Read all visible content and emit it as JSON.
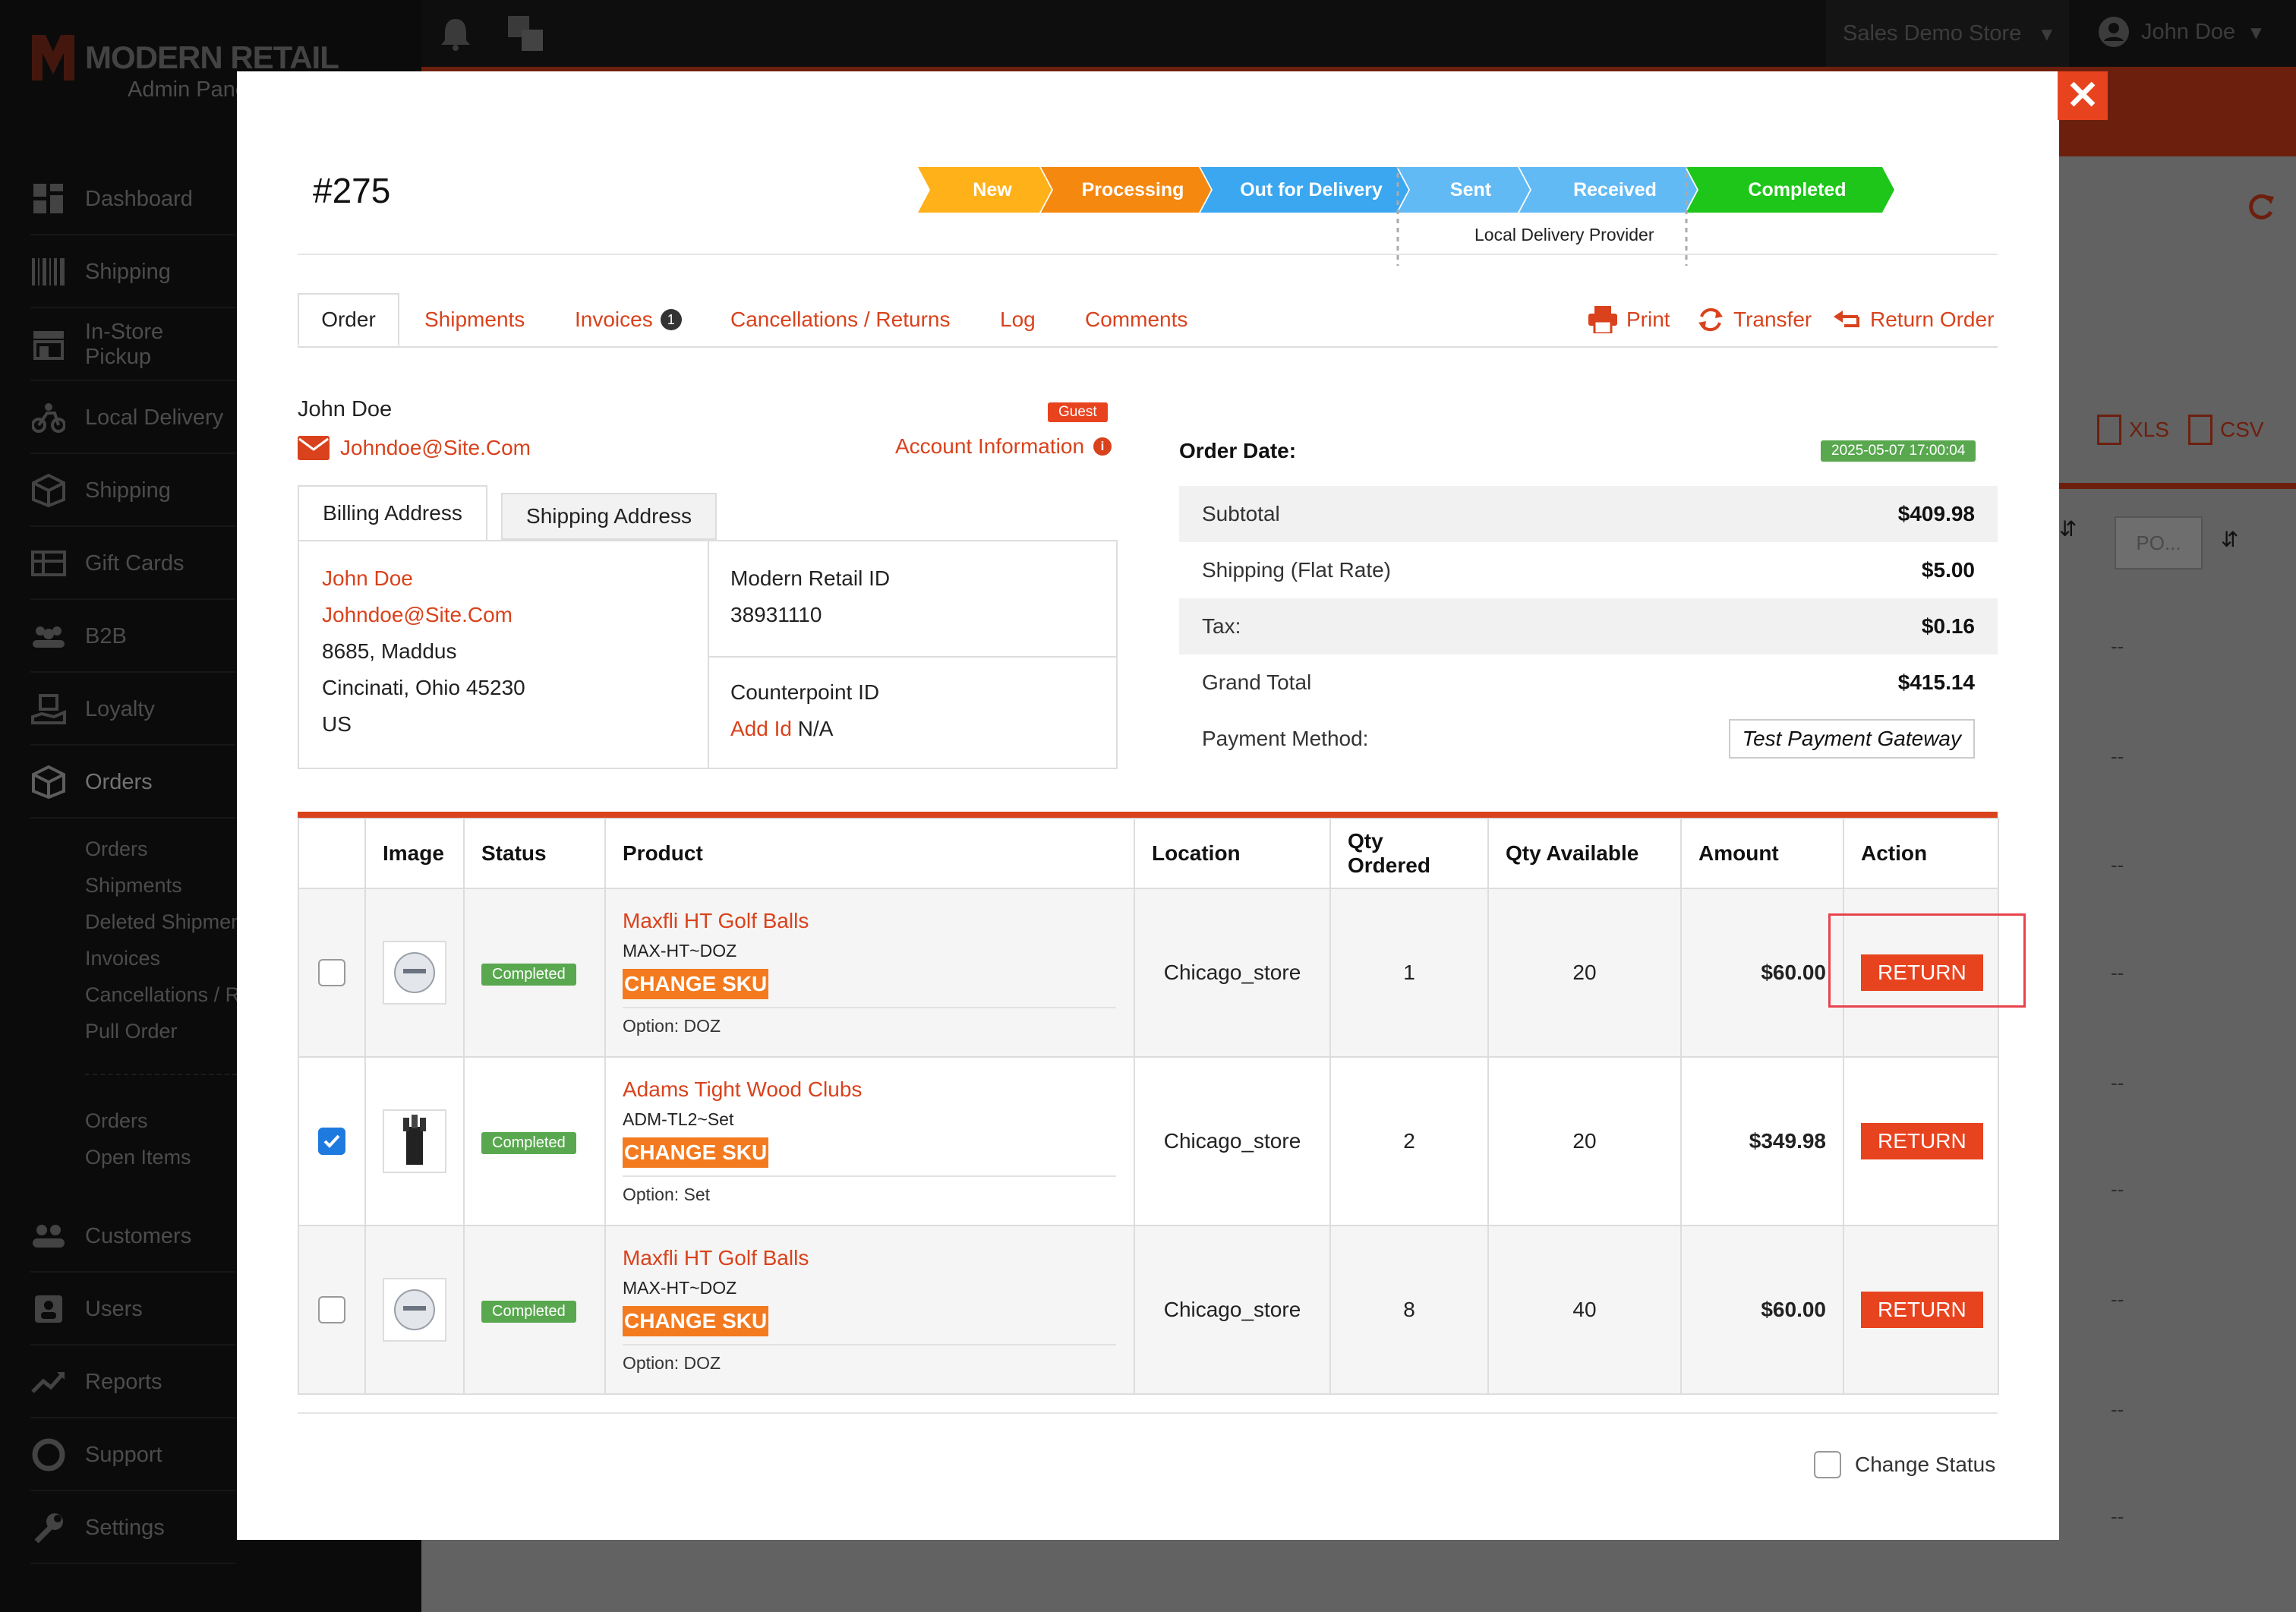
{
  "brand": {
    "logo_text": "MODERN RETAIL",
    "subtitle": "Admin Panel"
  },
  "topbar": {
    "store": "Sales Demo Store",
    "user": "John Doe"
  },
  "sidebar": {
    "items": [
      {
        "label": "Dashboard",
        "icon": "dashboard-icon"
      },
      {
        "label": "Shipping",
        "icon": "barcode-icon"
      },
      {
        "label": "In-Store Pickup",
        "icon": "store-icon"
      },
      {
        "label": "Local Delivery",
        "icon": "bike-icon"
      },
      {
        "label": "Shipping",
        "icon": "box-icon"
      },
      {
        "label": "Gift Cards",
        "icon": "gift-card-icon"
      },
      {
        "label": "B2B",
        "icon": "group-icon"
      },
      {
        "label": "Loyalty",
        "icon": "loyalty-icon"
      },
      {
        "label": "Orders",
        "icon": "orders-box-icon"
      }
    ],
    "orders_sub": [
      "Orders",
      "Shipments",
      "Deleted Shipments",
      "Invoices",
      "Cancellations / Returns",
      "Pull Order"
    ],
    "orders_sub2": [
      "Orders",
      "Open Items"
    ],
    "bottom_items": [
      {
        "label": "Customers",
        "icon": "customers-icon"
      },
      {
        "label": "Users",
        "icon": "user-icon"
      },
      {
        "label": "Reports",
        "icon": "trend-icon"
      },
      {
        "label": "Support",
        "icon": "lifebuoy-icon"
      },
      {
        "label": "Settings",
        "icon": "wrench-icon"
      }
    ]
  },
  "background": {
    "export_xls": "XLS",
    "export_csv": "CSV",
    "filter_placeholder": "PO...",
    "empty_cell": "--"
  },
  "order": {
    "number": "#275",
    "progress": {
      "steps": [
        {
          "label": "New",
          "color": "#ffb11a"
        },
        {
          "label": "Processing",
          "color": "#f5880f"
        },
        {
          "label": "Out for Delivery",
          "color": "#3aa7f0"
        },
        {
          "label": "Sent",
          "color": "#5cb8f5"
        },
        {
          "label": "Received",
          "color": "#5cb8f5"
        },
        {
          "label": "Completed",
          "color": "#1ec61a"
        }
      ],
      "provider_label": "Local Delivery Provider"
    },
    "tabs": [
      {
        "label": "Order",
        "active": true
      },
      {
        "label": "Shipments"
      },
      {
        "label": "Invoices",
        "badge": "1"
      },
      {
        "label": "Cancellations / Returns"
      },
      {
        "label": "Log"
      },
      {
        "label": "Comments"
      }
    ],
    "actions": {
      "print": "Print",
      "transfer": "Transfer",
      "return_order": "Return Order"
    },
    "customer": {
      "name": "John Doe",
      "email": "Johndoe@Site.Com",
      "guest_badge": "Guest",
      "account_info": "Account Information"
    },
    "address_tabs": {
      "billing": "Billing Address",
      "shipping": "Shipping Address"
    },
    "billing": {
      "name": "John Doe",
      "email": "Johndoe@Site.Com",
      "line1": "8685, Maddus",
      "line2": "Cincinati, Ohio 45230",
      "country": "US"
    },
    "ids": {
      "modern_label": "Modern Retail ID",
      "modern_value": "38931110",
      "counterpoint_label": "Counterpoint ID",
      "add_id": "Add Id",
      "counterpoint_value": "N/A"
    },
    "summary": {
      "date_label": "Order Date:",
      "date_value": "2025-05-07 17:00:04",
      "subtotal_label": "Subtotal",
      "subtotal": "$409.98",
      "shipping_label": "Shipping (Flat Rate)",
      "shipping": "$5.00",
      "tax_label": "Tax:",
      "tax": "$0.16",
      "total_label": "Grand Total",
      "total": "$415.14",
      "payment_label": "Payment Method:",
      "payment": "Test Payment Gateway"
    },
    "table": {
      "headers": [
        "",
        "Image",
        "Status",
        "Product",
        "Location",
        "Qty Ordered",
        "Qty Available",
        "Amount",
        "Action"
      ],
      "rows": [
        {
          "checked": false,
          "status": "Completed",
          "name": "Maxfli HT Golf Balls",
          "sku": "MAX-HT~DOZ",
          "change_sku": "CHANGE SKU",
          "option": "Option: DOZ",
          "location": "Chicago_store",
          "qty_ordered": "1",
          "qty_available": "20",
          "amount": "$60.00",
          "action": "RETURN",
          "highlight": true
        },
        {
          "checked": true,
          "status": "Completed",
          "name": "Adams Tight Wood Clubs",
          "sku": "ADM-TL2~Set",
          "change_sku": "CHANGE SKU",
          "option": "Option: Set",
          "location": "Chicago_store",
          "qty_ordered": "2",
          "qty_available": "20",
          "amount": "$349.98",
          "action": "RETURN"
        },
        {
          "checked": false,
          "status": "Completed",
          "name": "Maxfli HT Golf Balls",
          "sku": "MAX-HT~DOZ",
          "change_sku": "CHANGE SKU",
          "option": "Option: DOZ",
          "location": "Chicago_store",
          "qty_ordered": "8",
          "qty_available": "40",
          "amount": "$60.00",
          "action": "RETURN"
        }
      ]
    },
    "change_status_label": "Change Status"
  }
}
